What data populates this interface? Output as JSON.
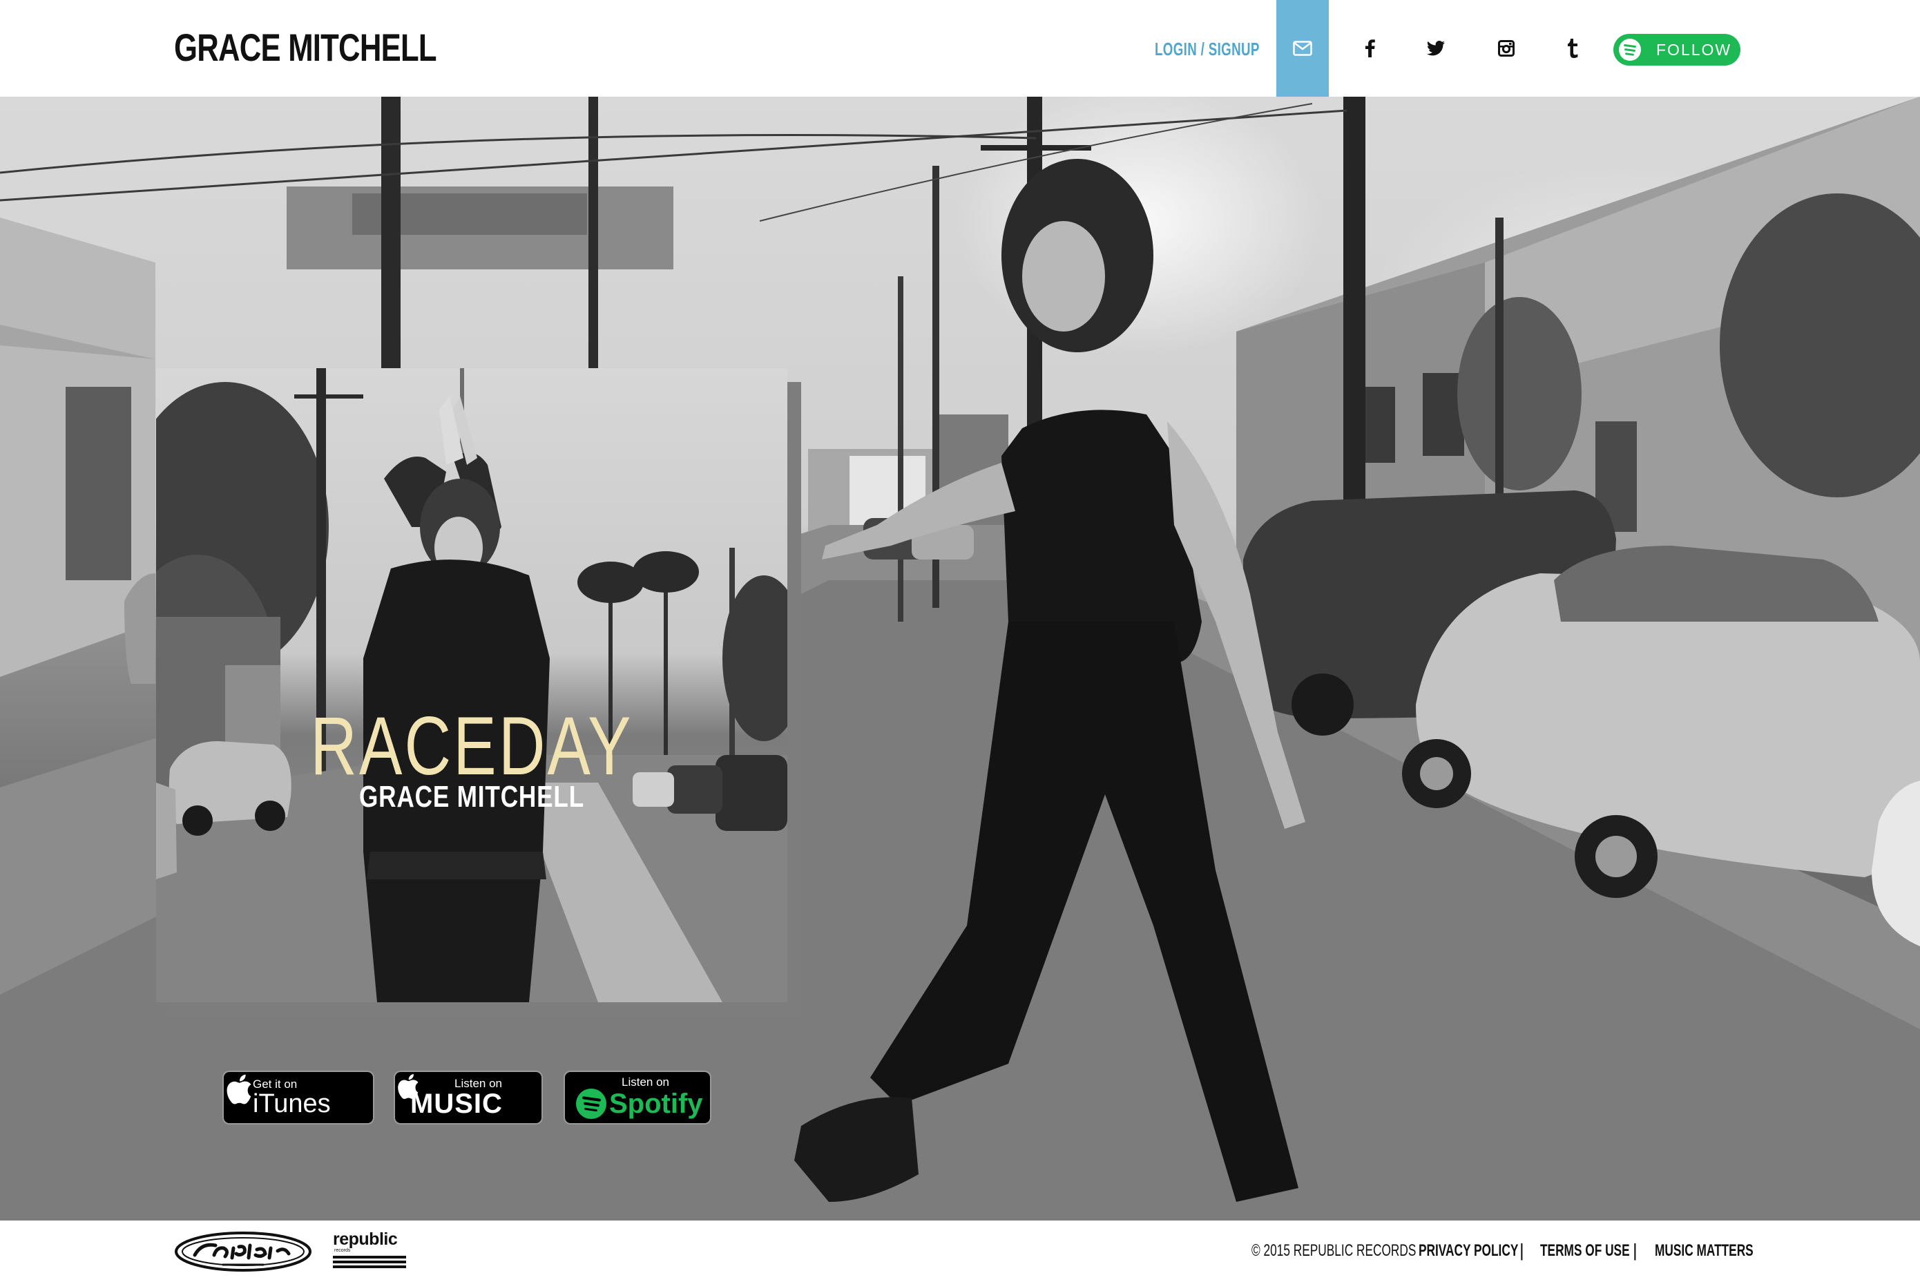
{
  "header": {
    "artist_name": "GRACE MITCHELL",
    "login_label": "LOGIN / SIGNUP",
    "follow_label": "FOLLOW",
    "social_icons": [
      "mail-icon",
      "facebook-icon",
      "twitter-icon",
      "instagram-icon",
      "tumblr-icon",
      "spotify-icon"
    ]
  },
  "album": {
    "title": "RACEDAY",
    "artist": "GRACE MITCHELL"
  },
  "stores": {
    "itunes": {
      "small": "Get it on",
      "big": "iTunes"
    },
    "apple_music": {
      "small": "Listen on",
      "big": "MUSIC"
    },
    "spotify": {
      "small": "Listen on",
      "big": "Spotify"
    }
  },
  "footer": {
    "labels": [
      "Casablanca Records",
      "republic records"
    ],
    "republic_text": "republic",
    "republic_sub": "records",
    "copyright": "© 2015 REPUBLIC RECORDS",
    "privacy": "PRIVACY POLICY",
    "terms": "TERMS OF USE",
    "music_matters": "MUSIC MATTERS",
    "separator": "|"
  },
  "colors": {
    "accent_blue": "#4ea6cf",
    "mail_bg": "#6cb6d9",
    "spotify_green": "#1db954",
    "album_title": "#f2e3b3"
  }
}
